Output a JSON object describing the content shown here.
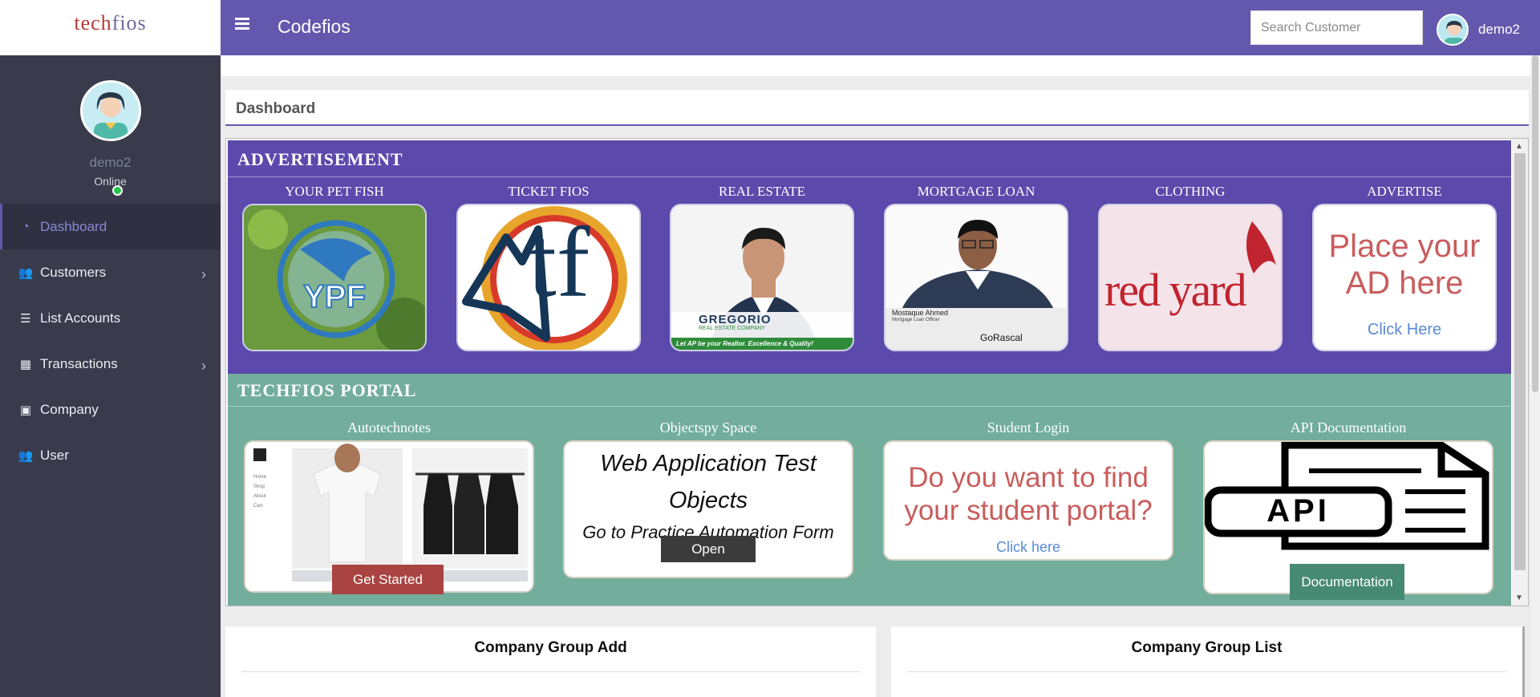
{
  "brand": {
    "logo_part1": "tech",
    "logo_part2": "fios"
  },
  "header": {
    "title": "Codefios",
    "search_placeholder": "Search Customer",
    "username": "demo2"
  },
  "sidebar": {
    "profile": {
      "name": "demo2",
      "status": "Online"
    },
    "items": [
      {
        "label": "Dashboard",
        "icon": "dashboard-icon",
        "active": true
      },
      {
        "label": "Customers",
        "icon": "users-icon",
        "has_submenu": true
      },
      {
        "label": "List Accounts",
        "icon": "list-icon"
      },
      {
        "label": "Transactions",
        "icon": "building-icon",
        "has_submenu": true
      },
      {
        "label": "Company",
        "icon": "briefcase-icon"
      },
      {
        "label": "User",
        "icon": "users-icon"
      }
    ]
  },
  "dashboard": {
    "title": "Dashboard"
  },
  "advertisement": {
    "title": "ADVERTISEMENT",
    "cards": [
      {
        "label": "YOUR PET FISH",
        "image_text": "YPF"
      },
      {
        "label": "TICKET FIOS",
        "image_text": "tf"
      },
      {
        "label": "REAL ESTATE",
        "image_text": "GREGORIO",
        "image_sub": "REAL ESTATE COMPANY",
        "image_banner": "Let AP be your Realtor. Excellence & Quality!"
      },
      {
        "label": "MORTGAGE LOAN",
        "image_text": "Mostaque Ahmed",
        "image_sub": "Mortgage Loan Officer",
        "image_brand": "GoRascal"
      },
      {
        "label": "CLOTHING",
        "image_text": "red yard"
      },
      {
        "label": "ADVERTISE",
        "image_text": "Place your AD here",
        "image_link": "Click Here"
      }
    ]
  },
  "portal": {
    "title": "TECHFIOS PORTAL",
    "cards": [
      {
        "label": "Autotechnotes",
        "button": "Get Started",
        "menu": [
          "Home",
          "Shop",
          "About",
          "Cart"
        ]
      },
      {
        "label": "Objectspy Space",
        "text1": "Web Application Test Objects",
        "text2": "Go to Practice Automation Form",
        "button": "Open"
      },
      {
        "label": "Student Login",
        "text1": "Do you want to find your student portal?",
        "link": "Click here"
      },
      {
        "label": "API Documentation",
        "image_text": "API",
        "button": "Documentation"
      }
    ]
  },
  "bottom": {
    "left_title": "Company Group Add",
    "right_title": "Company Group List"
  },
  "colors": {
    "header": "#6457ae",
    "sidebar": "#393b4c",
    "advertisement_bg": "#5b4aab",
    "portal_bg": "#72ae9b",
    "get_started": "#a94442",
    "documentation": "#468a73"
  }
}
